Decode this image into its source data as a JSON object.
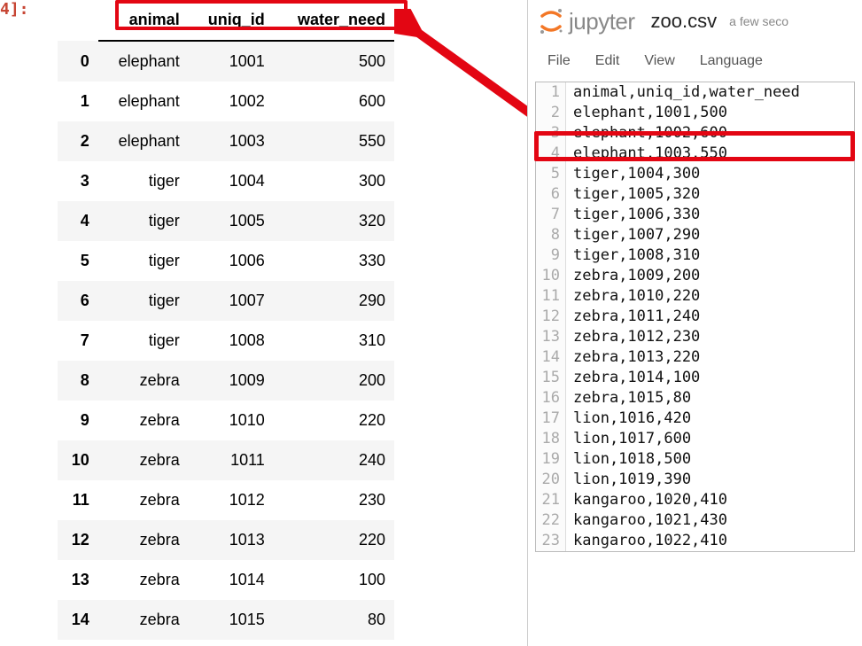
{
  "cell_prompt": "4]:",
  "dataframe": {
    "columns": [
      "animal",
      "uniq_id",
      "water_need"
    ],
    "rows": [
      {
        "idx": "0",
        "animal": "elephant",
        "uniq_id": "1001",
        "water_need": "500"
      },
      {
        "idx": "1",
        "animal": "elephant",
        "uniq_id": "1002",
        "water_need": "600"
      },
      {
        "idx": "2",
        "animal": "elephant",
        "uniq_id": "1003",
        "water_need": "550"
      },
      {
        "idx": "3",
        "animal": "tiger",
        "uniq_id": "1004",
        "water_need": "300"
      },
      {
        "idx": "4",
        "animal": "tiger",
        "uniq_id": "1005",
        "water_need": "320"
      },
      {
        "idx": "5",
        "animal": "tiger",
        "uniq_id": "1006",
        "water_need": "330"
      },
      {
        "idx": "6",
        "animal": "tiger",
        "uniq_id": "1007",
        "water_need": "290"
      },
      {
        "idx": "7",
        "animal": "tiger",
        "uniq_id": "1008",
        "water_need": "310"
      },
      {
        "idx": "8",
        "animal": "zebra",
        "uniq_id": "1009",
        "water_need": "200"
      },
      {
        "idx": "9",
        "animal": "zebra",
        "uniq_id": "1010",
        "water_need": "220"
      },
      {
        "idx": "10",
        "animal": "zebra",
        "uniq_id": "1011",
        "water_need": "240"
      },
      {
        "idx": "11",
        "animal": "zebra",
        "uniq_id": "1012",
        "water_need": "230"
      },
      {
        "idx": "12",
        "animal": "zebra",
        "uniq_id": "1013",
        "water_need": "220"
      },
      {
        "idx": "13",
        "animal": "zebra",
        "uniq_id": "1014",
        "water_need": "100"
      },
      {
        "idx": "14",
        "animal": "zebra",
        "uniq_id": "1015",
        "water_need": "80"
      }
    ]
  },
  "jupyter": {
    "logo_text": "jupyter",
    "filename": "zoo.csv",
    "savetime": "a few seco",
    "menu": [
      "File",
      "Edit",
      "View",
      "Language"
    ],
    "editor_lines": [
      {
        "n": "1",
        "t": "animal,uniq_id,water_need"
      },
      {
        "n": "2",
        "t": "elephant,1001,500"
      },
      {
        "n": "3",
        "t": "elephant,1002,600"
      },
      {
        "n": "4",
        "t": "elephant,1003,550"
      },
      {
        "n": "5",
        "t": "tiger,1004,300"
      },
      {
        "n": "6",
        "t": "tiger,1005,320"
      },
      {
        "n": "7",
        "t": "tiger,1006,330"
      },
      {
        "n": "8",
        "t": "tiger,1007,290"
      },
      {
        "n": "9",
        "t": "tiger,1008,310"
      },
      {
        "n": "10",
        "t": "zebra,1009,200"
      },
      {
        "n": "11",
        "t": "zebra,1010,220"
      },
      {
        "n": "12",
        "t": "zebra,1011,240"
      },
      {
        "n": "13",
        "t": "zebra,1012,230"
      },
      {
        "n": "14",
        "t": "zebra,1013,220"
      },
      {
        "n": "15",
        "t": "zebra,1014,100"
      },
      {
        "n": "16",
        "t": "zebra,1015,80"
      },
      {
        "n": "17",
        "t": "lion,1016,420"
      },
      {
        "n": "18",
        "t": "lion,1017,600"
      },
      {
        "n": "19",
        "t": "lion,1018,500"
      },
      {
        "n": "20",
        "t": "lion,1019,390"
      },
      {
        "n": "21",
        "t": "kangaroo,1020,410"
      },
      {
        "n": "22",
        "t": "kangaroo,1021,430"
      },
      {
        "n": "23",
        "t": "kangaroo,1022,410"
      }
    ]
  }
}
